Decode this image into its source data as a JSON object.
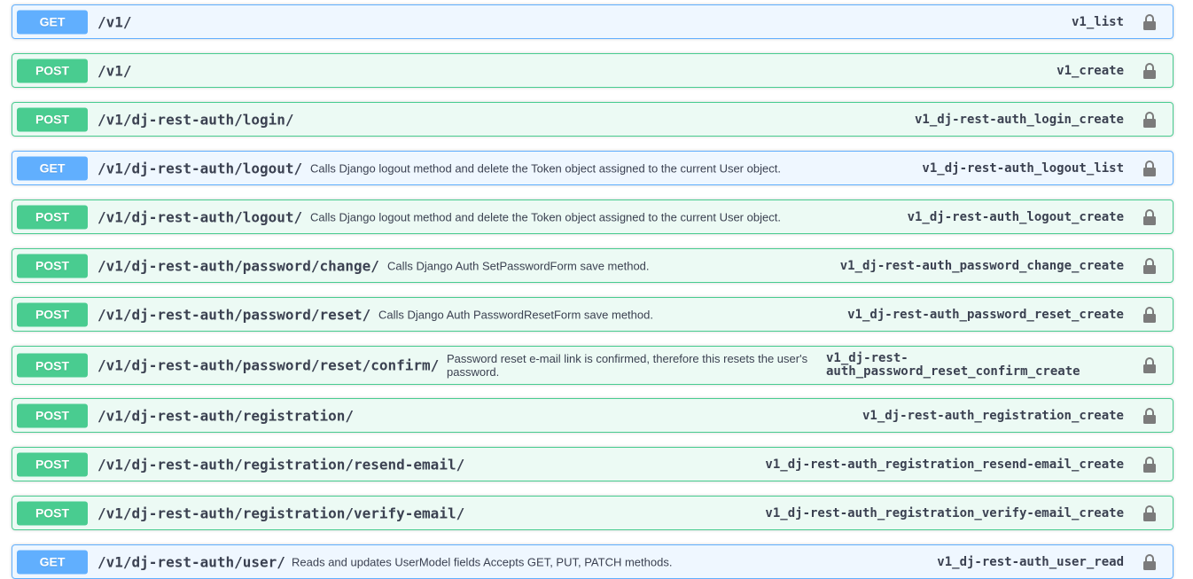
{
  "colors": {
    "get": "#61affe",
    "post": "#49cc90",
    "text": "#3b4151",
    "lock": "#7b7b7b"
  },
  "operations": [
    {
      "method": "GET",
      "path": "/v1/",
      "description": "",
      "operation_id": "v1_list",
      "icon": "lock-icon"
    },
    {
      "method": "POST",
      "path": "/v1/",
      "description": "",
      "operation_id": "v1_create",
      "icon": "lock-icon"
    },
    {
      "method": "POST",
      "path": "/v1/dj-rest-auth/login/",
      "description": "",
      "operation_id": "v1_dj-rest-auth_login_create",
      "icon": "lock-icon"
    },
    {
      "method": "GET",
      "path": "/v1/dj-rest-auth/logout/",
      "description": "Calls Django logout method and delete the Token object assigned to the current User object.",
      "operation_id": "v1_dj-rest-auth_logout_list",
      "icon": "lock-icon"
    },
    {
      "method": "POST",
      "path": "/v1/dj-rest-auth/logout/",
      "description": "Calls Django logout method and delete the Token object assigned to the current User object.",
      "operation_id": "v1_dj-rest-auth_logout_create",
      "icon": "lock-icon"
    },
    {
      "method": "POST",
      "path": "/v1/dj-rest-auth/password/change/",
      "description": "Calls Django Auth SetPasswordForm save method.",
      "operation_id": "v1_dj-rest-auth_password_change_create",
      "icon": "lock-icon"
    },
    {
      "method": "POST",
      "path": "/v1/dj-rest-auth/password/reset/",
      "description": "Calls Django Auth PasswordResetForm save method.",
      "operation_id": "v1_dj-rest-auth_password_reset_create",
      "icon": "lock-icon"
    },
    {
      "method": "POST",
      "path": "/v1/dj-rest-auth/password/reset/confirm/",
      "description": "Password reset e-mail link is confirmed, therefore this resets the user's password.",
      "operation_id": "v1_dj-rest-auth_password_reset_confirm_create",
      "icon": "lock-icon"
    },
    {
      "method": "POST",
      "path": "/v1/dj-rest-auth/registration/",
      "description": "",
      "operation_id": "v1_dj-rest-auth_registration_create",
      "icon": "lock-icon"
    },
    {
      "method": "POST",
      "path": "/v1/dj-rest-auth/registration/resend-email/",
      "description": "",
      "operation_id": "v1_dj-rest-auth_registration_resend-email_create",
      "icon": "lock-icon"
    },
    {
      "method": "POST",
      "path": "/v1/dj-rest-auth/registration/verify-email/",
      "description": "",
      "operation_id": "v1_dj-rest-auth_registration_verify-email_create",
      "icon": "lock-icon"
    },
    {
      "method": "GET",
      "path": "/v1/dj-rest-auth/user/",
      "description": "Reads and updates UserModel fields Accepts GET, PUT, PATCH methods.",
      "operation_id": "v1_dj-rest-auth_user_read",
      "icon": "lock-icon"
    }
  ]
}
